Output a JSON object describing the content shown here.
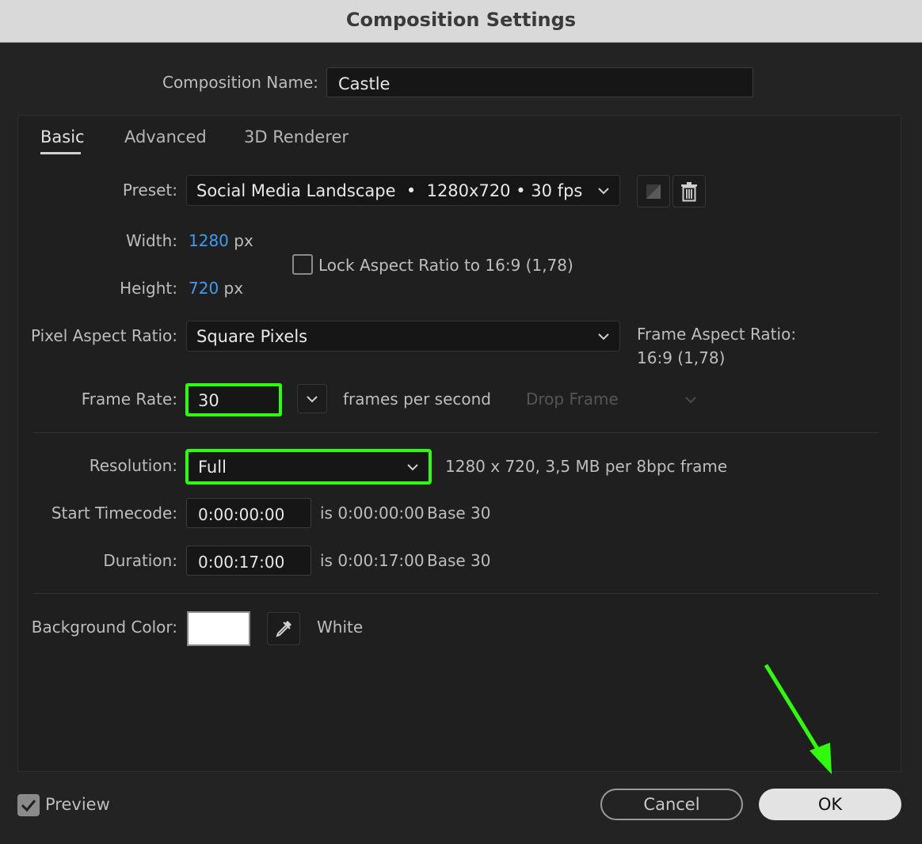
{
  "window": {
    "title": "Composition Settings"
  },
  "comp_name": {
    "label": "Composition Name:",
    "value": "Castle"
  },
  "tabs": [
    {
      "label": "Basic",
      "active": true
    },
    {
      "label": "Advanced",
      "active": false
    },
    {
      "label": "3D Renderer",
      "active": false
    }
  ],
  "preset": {
    "label": "Preset:",
    "value": "Social Media Landscape  •  1280x720 • 30 fps"
  },
  "width": {
    "label": "Width:",
    "value": "1280",
    "unit": "px"
  },
  "height": {
    "label": "Height:",
    "value": "720",
    "unit": "px"
  },
  "lock_aspect": {
    "label": "Lock Aspect Ratio to 16:9 (1,78)",
    "checked": false
  },
  "pixel_aspect": {
    "label": "Pixel Aspect Ratio:",
    "value": "Square Pixels"
  },
  "frame_aspect": {
    "label": "Frame Aspect Ratio:",
    "value": "16:9 (1,78)"
  },
  "frame_rate": {
    "label": "Frame Rate:",
    "value": "30",
    "unit": "frames per second",
    "drop_frame": "Drop Frame"
  },
  "resolution": {
    "label": "Resolution:",
    "value": "Full",
    "info": "1280 x 720, 3,5 MB per 8bpc frame"
  },
  "start_timecode": {
    "label": "Start Timecode:",
    "value": "0:00:00:00",
    "is": "is 0:00:00:00",
    "base": "Base 30"
  },
  "duration": {
    "label": "Duration:",
    "value": "0:00:17:00",
    "is": "is 0:00:17:00",
    "base": "Base 30"
  },
  "background": {
    "label": "Background Color:",
    "color_name": "White",
    "color": "#ffffff"
  },
  "preview": {
    "label": "Preview",
    "checked": true
  },
  "buttons": {
    "cancel": "Cancel",
    "ok": "OK"
  },
  "colors": {
    "highlight": "#2efc0c",
    "link": "#3d9bf0"
  }
}
